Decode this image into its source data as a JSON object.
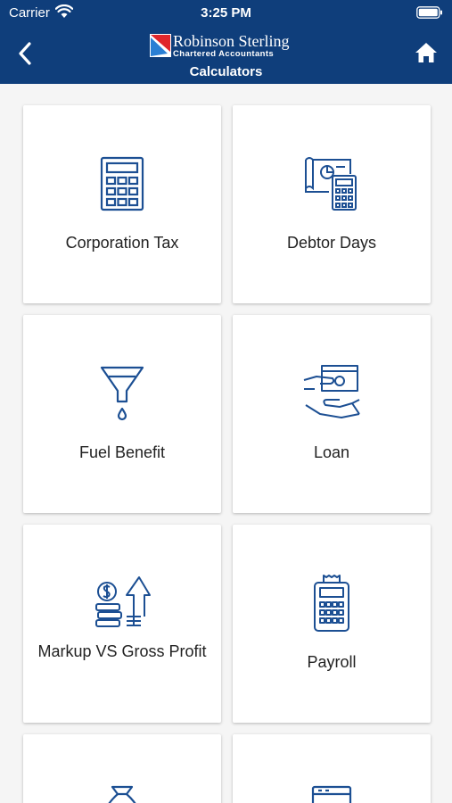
{
  "status_bar": {
    "carrier": "Carrier",
    "time": "3:25 PM"
  },
  "header": {
    "brand_name": "Robinson Sterling",
    "brand_sub": "Chartered Accountants",
    "title": "Calculators"
  },
  "colors": {
    "header_bg": "#0f3e7b",
    "icon_blue": "#1c4f93",
    "logo_red": "#e0262b"
  },
  "calculators": [
    {
      "label": "Corporation Tax",
      "icon": "calculator-icon"
    },
    {
      "label": "Debtor Days",
      "icon": "invoice-calculator-icon"
    },
    {
      "label": "Fuel Benefit",
      "icon": "funnel-drop-icon"
    },
    {
      "label": "Loan",
      "icon": "cash-hand-icon"
    },
    {
      "label": "Markup VS Gross Profit",
      "icon": "coins-arrow-up-icon"
    },
    {
      "label": "Payroll",
      "icon": "card-terminal-icon"
    },
    {
      "label": "",
      "icon": "money-bag-icon"
    },
    {
      "label": "",
      "icon": "window-icon"
    }
  ]
}
